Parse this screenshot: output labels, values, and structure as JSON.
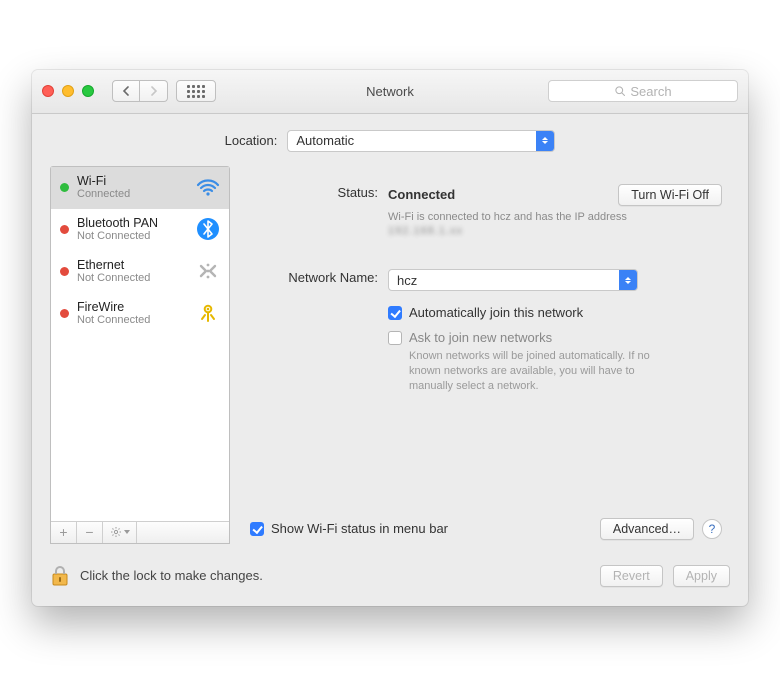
{
  "window": {
    "title": "Network"
  },
  "search": {
    "placeholder": "Search"
  },
  "location": {
    "label": "Location:",
    "value": "Automatic"
  },
  "sidebar": {
    "items": [
      {
        "name": "Wi-Fi",
        "sub": "Connected",
        "status": "green",
        "icon": "wifi"
      },
      {
        "name": "Bluetooth PAN",
        "sub": "Not Connected",
        "status": "red",
        "icon": "bluetooth"
      },
      {
        "name": "Ethernet",
        "sub": "Not Connected",
        "status": "red",
        "icon": "ethernet"
      },
      {
        "name": "FireWire",
        "sub": "Not Connected",
        "status": "red",
        "icon": "firewire"
      }
    ]
  },
  "main": {
    "status_label": "Status:",
    "status_value": "Connected",
    "toggle_button": "Turn Wi-Fi Off",
    "status_desc_prefix": "Wi-Fi is connected to hcz and has the IP address ",
    "status_desc_ip": "192.168.1.xx",
    "network_name_label": "Network Name:",
    "network_name_value": "hcz",
    "auto_join_label": "Automatically join this network",
    "ask_join_label": "Ask to join new networks",
    "ask_join_hint": "Known networks will be joined automatically. If no known networks are available, you will have to manually select a network.",
    "show_status_label": "Show Wi-Fi status in menu bar",
    "advanced_button": "Advanced…"
  },
  "footer": {
    "lock_text": "Click the lock to make changes.",
    "revert": "Revert",
    "apply": "Apply"
  }
}
